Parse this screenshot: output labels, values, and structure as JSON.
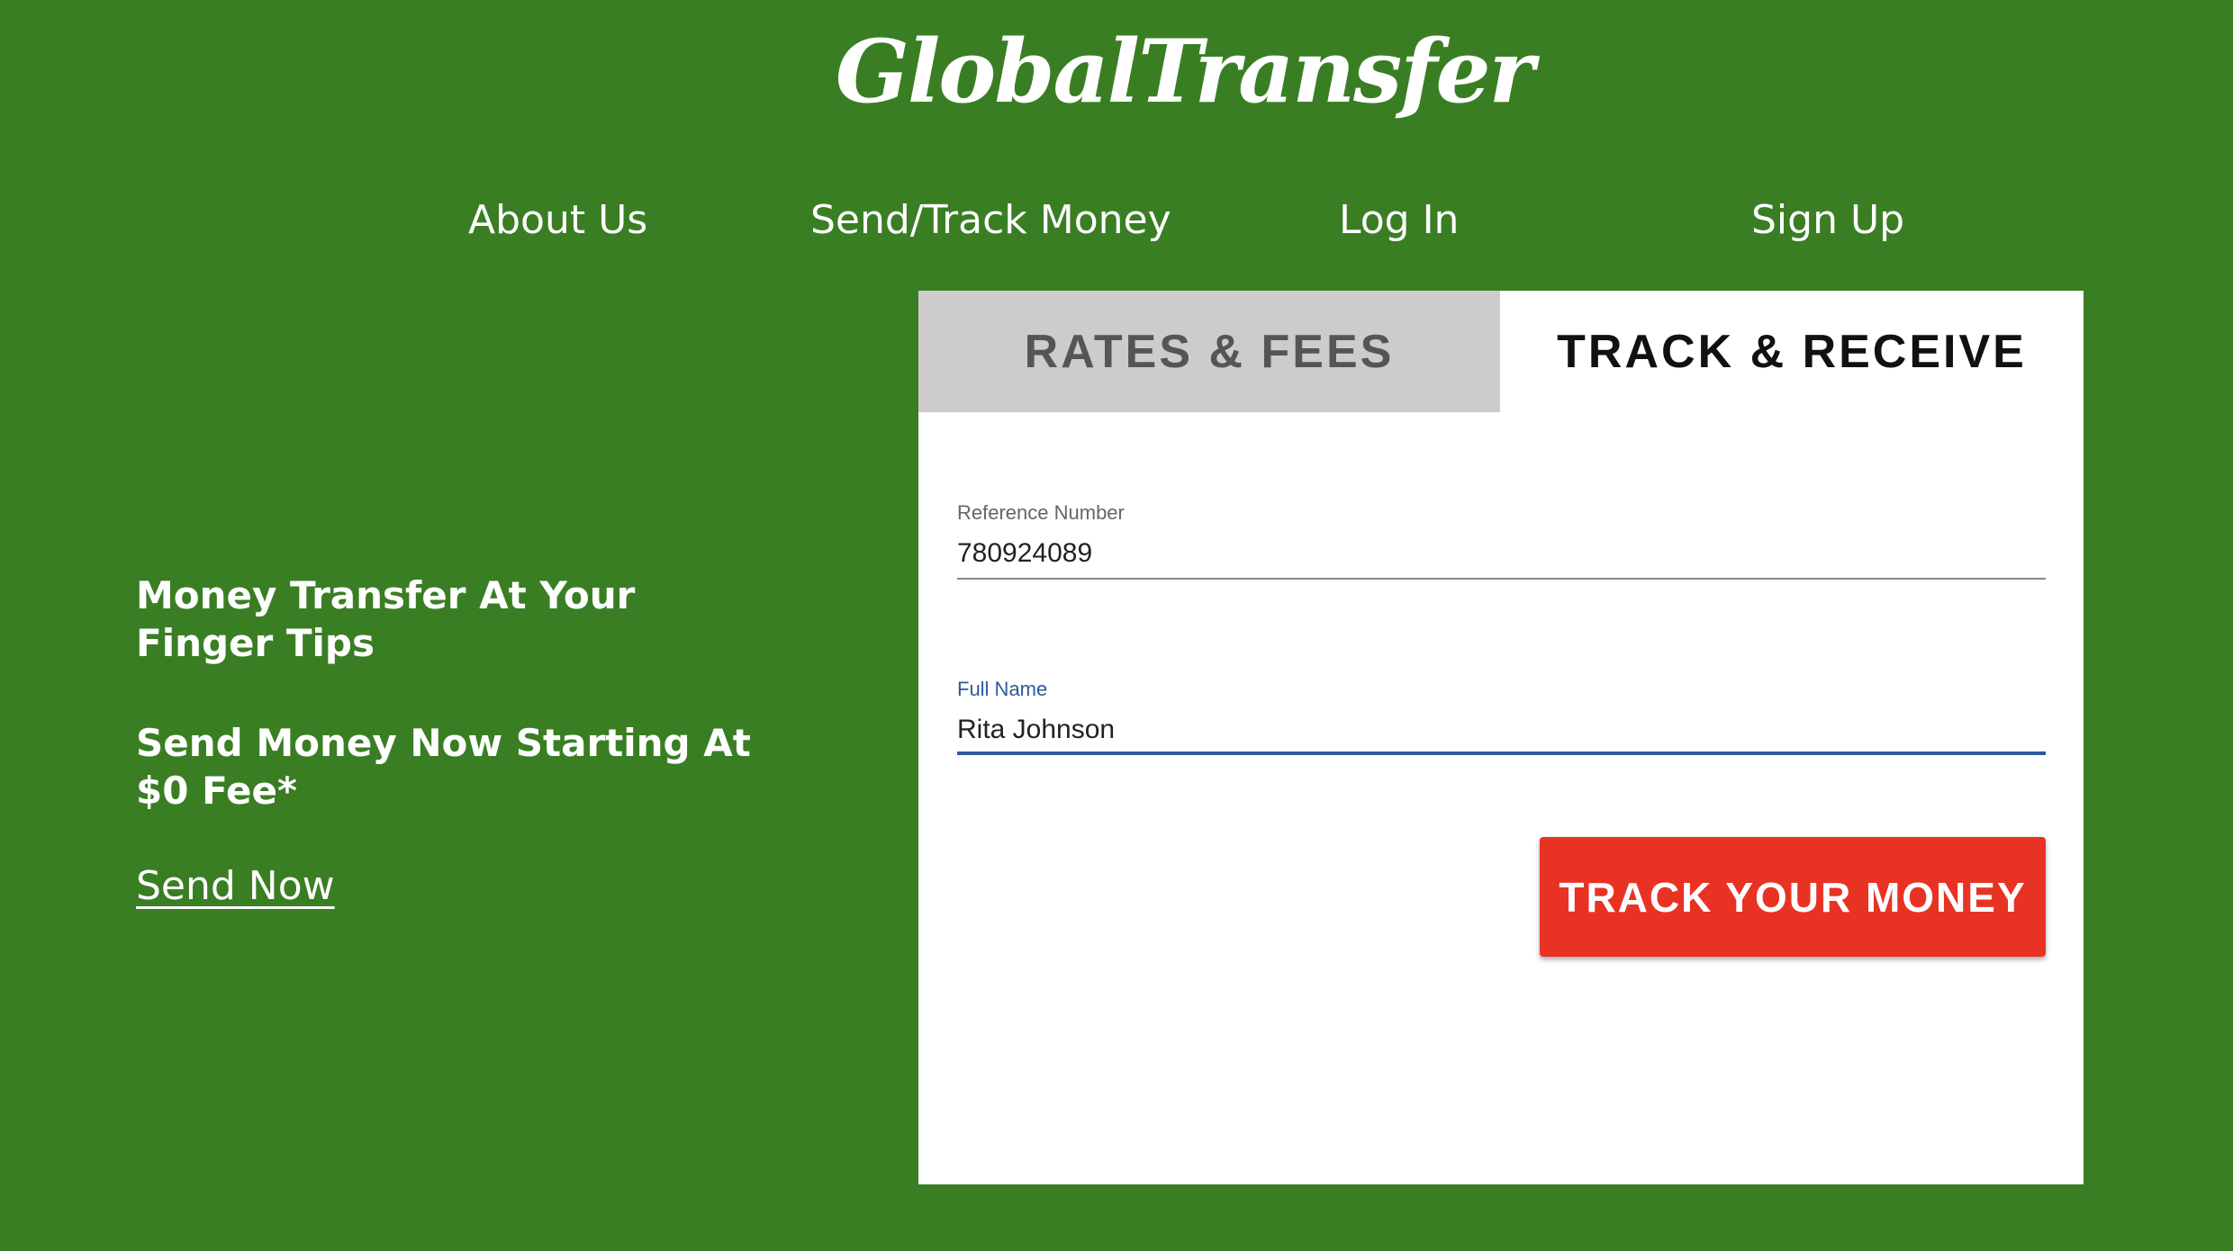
{
  "brand": {
    "logo_text": "GlobalTransfer"
  },
  "nav": {
    "items": [
      {
        "label": "About Us"
      },
      {
        "label": "Send/Track Money"
      },
      {
        "label": "Log In"
      },
      {
        "label": "Sign Up"
      }
    ]
  },
  "hero": {
    "tagline": "Money Transfer At Your Finger Tips",
    "promo": "Send Money Now Starting At $0 Fee*",
    "cta_link": "Send Now"
  },
  "panel": {
    "tabs": [
      {
        "label": "RATES & FEES",
        "active": false
      },
      {
        "label": "TRACK & RECEIVE",
        "active": true
      }
    ],
    "reference_field": {
      "label": "Reference Number",
      "value": "780924089"
    },
    "name_field": {
      "label": "Full Name",
      "value": "Rita Johnson",
      "focused": true
    },
    "submit_label": "TRACK YOUR MONEY"
  },
  "colors": {
    "background": "#3a7e24",
    "accent_button": "#e83324",
    "inactive_tab": "#cdcbcb",
    "focus_blue": "#2e5a9c"
  }
}
